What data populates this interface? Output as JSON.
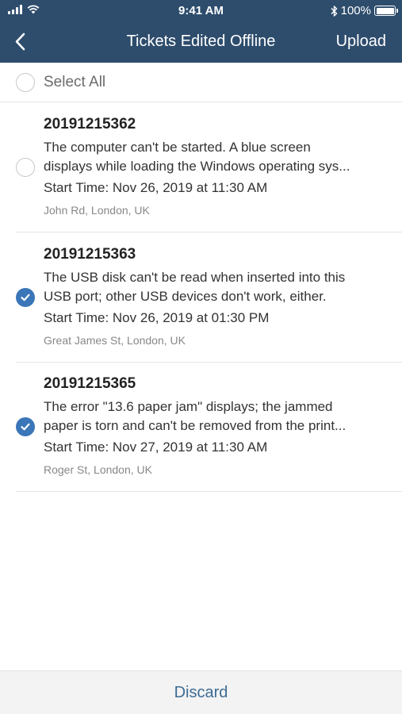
{
  "status_bar": {
    "time": "9:41 AM",
    "battery": "100%"
  },
  "nav": {
    "title": "Tickets Edited Offline",
    "upload_label": "Upload"
  },
  "select_all": {
    "label": "Select All",
    "checked": false
  },
  "tickets": [
    {
      "id": "20191215362",
      "description": [
        "The computer can't be started. A blue screen",
        "displays while loading the Windows operating sys..."
      ],
      "start_time": "Start Time: Nov 26, 2019 at 11:30 AM",
      "location": "John Rd, London, UK",
      "checked": false
    },
    {
      "id": "20191215363",
      "description": [
        "The USB disk can't be read when inserted into this",
        "USB port; other USB devices don't work, either."
      ],
      "start_time": "Start Time: Nov 26, 2019 at 01:30 PM",
      "location": "Great James St, London, UK",
      "checked": true
    },
    {
      "id": "20191215365",
      "description": [
        "The error \"13.6 paper jam\" displays; the jammed",
        "paper is torn and can't be removed from the print..."
      ],
      "start_time": "Start Time: Nov 27, 2019 at 11:30 AM",
      "location": "Roger St, London, UK",
      "checked": true
    }
  ],
  "footer": {
    "discard_label": "Discard"
  },
  "colors": {
    "header": "#2e4d6d",
    "accent": "#3a76b8",
    "discard": "#3c6b95"
  }
}
